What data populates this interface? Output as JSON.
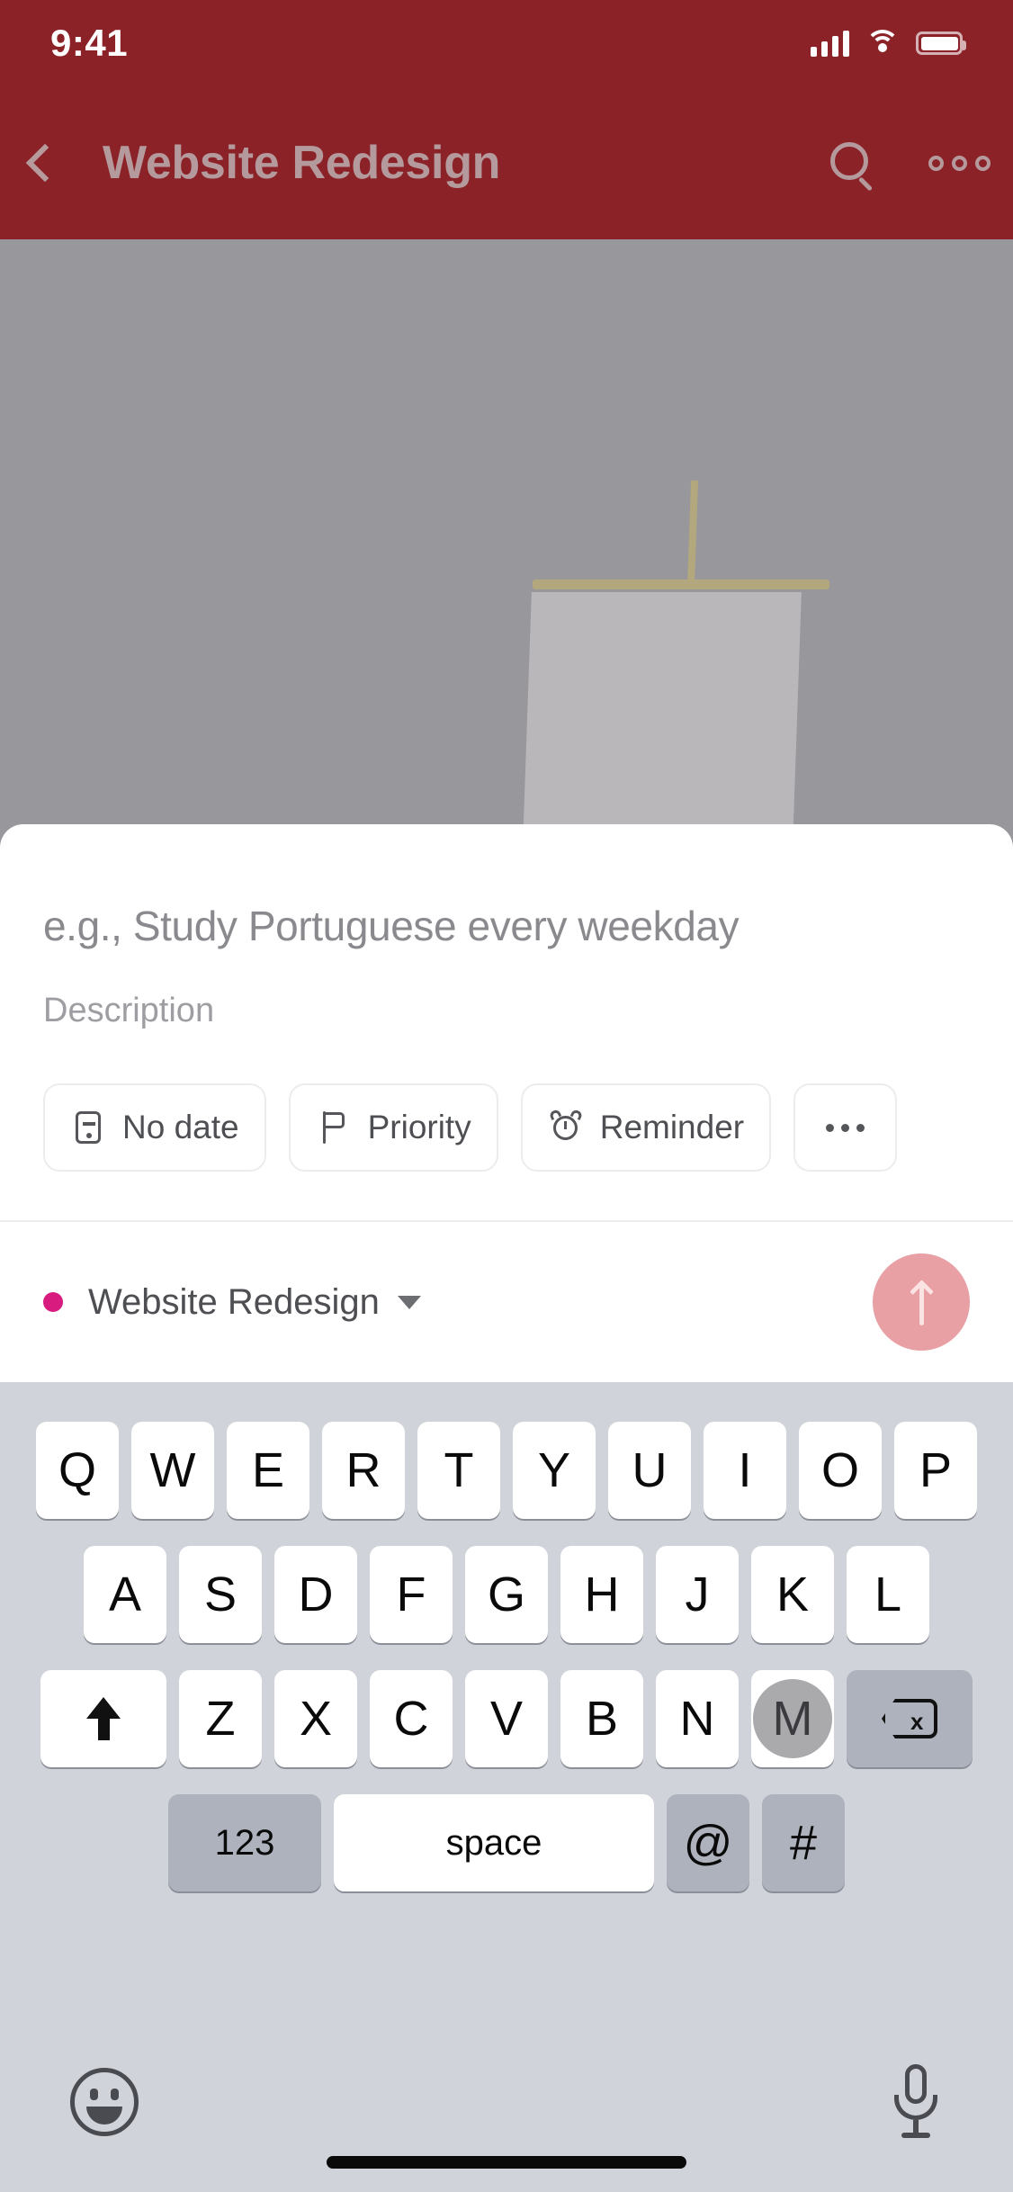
{
  "status_bar": {
    "time": "9:41",
    "signal_icon": "signal-bars-icon",
    "wifi_icon": "wifi-icon",
    "battery_icon": "battery-icon"
  },
  "nav": {
    "back_icon": "chevron-left-icon",
    "title": "Website Redesign",
    "search_icon": "search-icon",
    "overflow_icon": "more-horizontal-icon"
  },
  "composer": {
    "task_placeholder": "e.g., Study Portuguese every weekday",
    "description_placeholder": "Description",
    "chips": [
      {
        "icon": "calendar-icon",
        "label": "No date"
      },
      {
        "icon": "flag-icon",
        "label": "Priority"
      },
      {
        "icon": "alarm-clock-icon",
        "label": "Reminder"
      },
      {
        "icon": "more-horizontal-icon",
        "label": ""
      }
    ],
    "project": {
      "name": "Website Redesign",
      "dot_color": "#d81b7e",
      "caret_icon": "chevron-down-icon"
    },
    "send": {
      "icon": "arrow-up-icon",
      "color": "#e8a0a4"
    }
  },
  "keyboard": {
    "row1": [
      "Q",
      "W",
      "E",
      "R",
      "T",
      "Y",
      "U",
      "I",
      "O",
      "P"
    ],
    "row2": [
      "A",
      "S",
      "D",
      "F",
      "G",
      "H",
      "J",
      "K",
      "L"
    ],
    "row3": [
      "Z",
      "X",
      "C",
      "V",
      "B",
      "N",
      "M"
    ],
    "shift_icon": "shift-arrow-up-icon",
    "delete_icon": "backspace-icon",
    "numbers_label": "123",
    "space_label": "space",
    "at_label": "@",
    "hash_label": "#",
    "pressed_key": "M",
    "emoji_icon": "emoji-smiley-icon",
    "mic_icon": "microphone-icon"
  },
  "theme": {
    "header_bg": "#8b2228",
    "hero_bg": "#9a999d",
    "keyboard_bg": "#d1d3da"
  }
}
